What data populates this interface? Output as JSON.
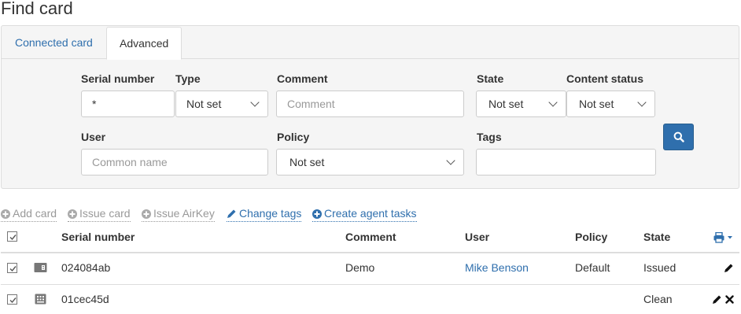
{
  "page": {
    "title": "Find card"
  },
  "tabs": [
    {
      "label": "Connected card",
      "active": false
    },
    {
      "label": "Advanced",
      "active": true
    }
  ],
  "form": {
    "serial_number": {
      "label": "Serial number",
      "value": "*"
    },
    "type": {
      "label": "Type",
      "value": "Not set"
    },
    "comment": {
      "label": "Comment",
      "placeholder": "Comment"
    },
    "state": {
      "label": "State",
      "value": "Not set"
    },
    "content_status": {
      "label": "Content status",
      "value": "Not set"
    },
    "user": {
      "label": "User",
      "placeholder": "Common name"
    },
    "policy": {
      "label": "Policy",
      "value": "Not set"
    },
    "tags": {
      "label": "Tags",
      "value": ""
    }
  },
  "toolbar": {
    "add_card": "Add card",
    "issue_card": "Issue card",
    "issue_airkey": "Issue AirKey",
    "change_tags": "Change tags",
    "create_agent_tasks": "Create agent tasks"
  },
  "table": {
    "columns": {
      "serial_number": "Serial number",
      "comment": "Comment",
      "user": "User",
      "policy": "Policy",
      "state": "State"
    },
    "rows": [
      {
        "icon": "smart-card-reader-icon",
        "serial": "024084ab",
        "comment": "Demo",
        "user": "Mike Benson",
        "policy": "Default",
        "state": "Issued"
      },
      {
        "icon": "virtual-card-icon",
        "serial": "01cec45d",
        "comment": "",
        "user": "",
        "policy": "",
        "state": "Clean"
      }
    ]
  },
  "colors": {
    "link": "#2f6fad",
    "primary_button": "#2f6fad",
    "panel_bg": "#f5f5f5",
    "disabled_text": "#999999"
  }
}
